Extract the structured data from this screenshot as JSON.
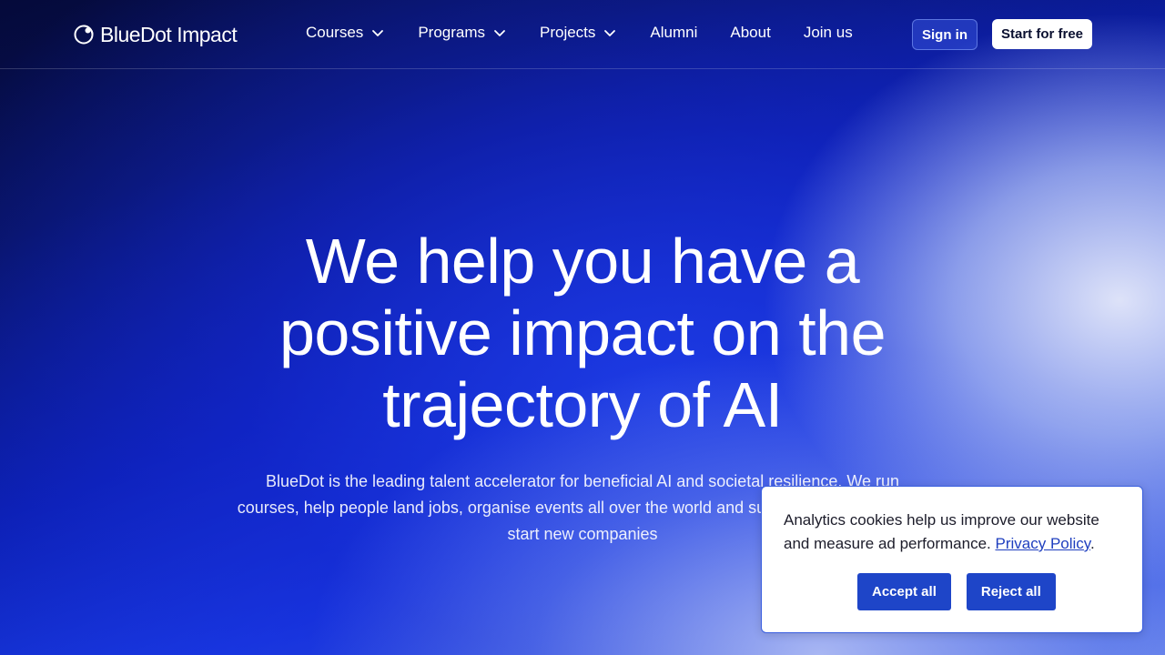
{
  "brand": {
    "name": "BlueDot Impact",
    "icon": "bluedot-logo-icon"
  },
  "nav": {
    "items": [
      {
        "label": "Courses",
        "dropdown": true
      },
      {
        "label": "Programs",
        "dropdown": true
      },
      {
        "label": "Projects",
        "dropdown": true
      },
      {
        "label": "Alumni",
        "dropdown": false
      },
      {
        "label": "About",
        "dropdown": false
      },
      {
        "label": "Join us",
        "dropdown": false
      }
    ],
    "sign_in": "Sign in",
    "start": "Start for free"
  },
  "hero": {
    "title": "We help you have a positive impact on the trajectory of AI",
    "subtitle": "BlueDot is the leading talent accelerator for beneficial AI and societal resilience. We run courses, help people land jobs, organise events all over the world and support entrepreneurs to start new companies"
  },
  "cookie_banner": {
    "text": "Analytics cookies help us improve our website and measure ad performance.",
    "link": "Privacy Policy",
    "suffix": ".",
    "accept": "Accept all",
    "reject": "Reject all"
  },
  "colors": {
    "accent_button": "#1e45c8",
    "link": "#1f3fbf",
    "background_dark": "#050a3a",
    "background_blue": "#1a3ce6"
  }
}
